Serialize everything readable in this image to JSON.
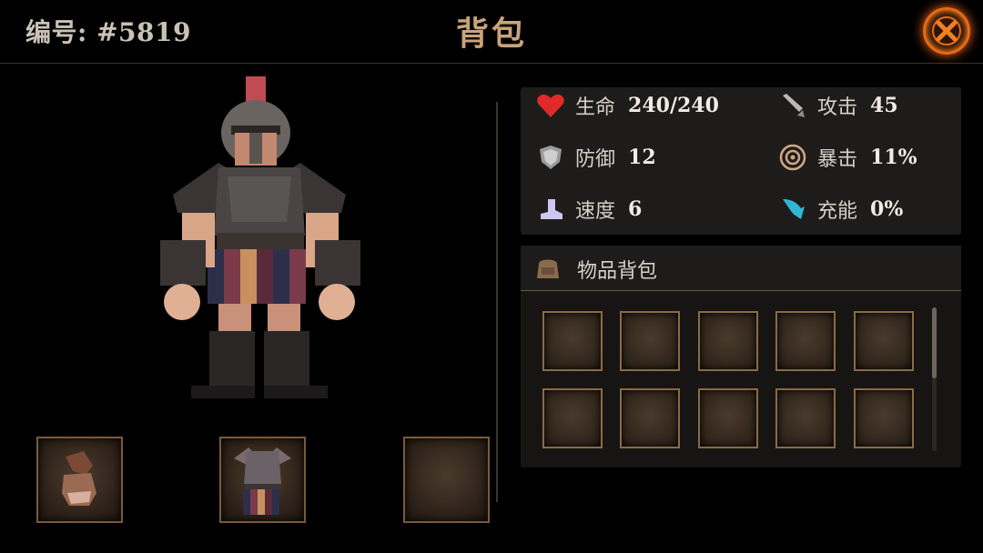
{
  "header": {
    "hero_id": "编号: #5819",
    "title": "背包",
    "close_icon": "close-x-icon",
    "accent": "#e86a14"
  },
  "hero": {
    "figure": "armored-warrior"
  },
  "equipment": [
    {
      "item": "leather-gauntlet",
      "icon": "gauntlet-icon"
    },
    {
      "item": "plate-armor",
      "icon": "armor-icon"
    },
    {
      "item": "",
      "icon": ""
    }
  ],
  "stats": {
    "hp": {
      "label": "生命",
      "value": "240/240",
      "icon": "heart-icon",
      "color": "#e02a2a"
    },
    "attack": {
      "label": "攻击",
      "value": "45",
      "icon": "sword-icon"
    },
    "defense": {
      "label": "防御",
      "value": "12",
      "icon": "shield-icon"
    },
    "crit": {
      "label": "暴击",
      "value": "11%",
      "icon": "crit-target-icon"
    },
    "speed": {
      "label": "速度",
      "value": "6",
      "icon": "boot-icon"
    },
    "energy": {
      "label": "充能",
      "value": "0%",
      "icon": "energy-wing-icon",
      "color": "#2fb8d4"
    }
  },
  "bag": {
    "title": "物品背包",
    "icon": "backpack-icon",
    "slots": [
      "",
      "",
      "",
      "",
      "",
      "",
      "",
      "",
      "",
      ""
    ]
  }
}
